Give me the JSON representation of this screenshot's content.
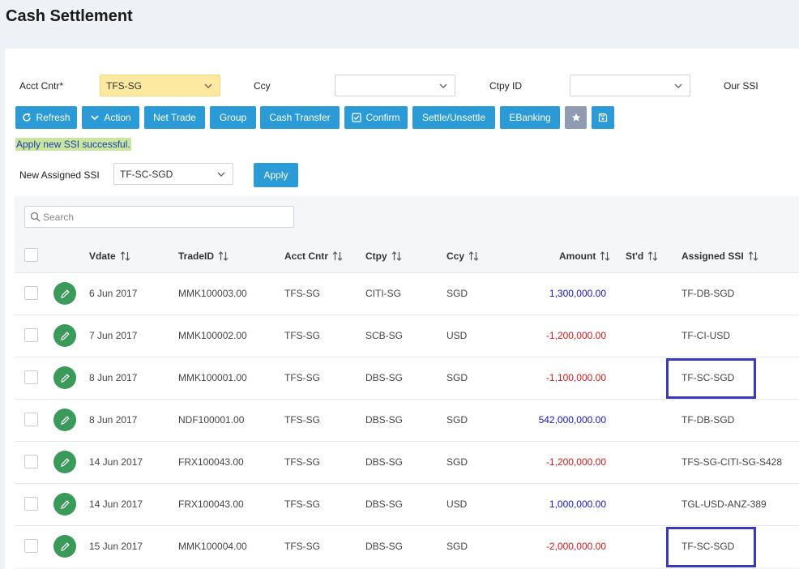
{
  "page": {
    "title": "Cash Settlement"
  },
  "filters": {
    "acct_cntr_label": "Acct Cntr*",
    "acct_cntr_value": "TFS-SG",
    "ccy_label": "Ccy",
    "ccy_value": "",
    "ctpy_label": "Ctpy ID",
    "ctpy_value": "",
    "our_ssi_label": "Our SSI"
  },
  "toolbar": {
    "refresh": "Refresh",
    "action": "Action",
    "net_trade": "Net Trade",
    "group": "Group",
    "cash_transfer": "Cash Transfer",
    "confirm": "Confirm",
    "settle": "Settle/Unsettle",
    "ebanking": "EBanking"
  },
  "message": "Apply new SSI successful.",
  "assign": {
    "label": "New Assigned SSI",
    "value": "TF-SC-SGD",
    "apply": "Apply"
  },
  "search": {
    "placeholder": "Search"
  },
  "columns": {
    "vdate": "Vdate",
    "tradeid": "TradeID",
    "acct": "Acct Cntr",
    "ctpy": "Ctpy",
    "ccy": "Ccy",
    "amount": "Amount",
    "std": "St'd",
    "ssi": "Assigned SSI"
  },
  "colors": {
    "accent": "#2a9bd6",
    "positive": "#1515c9",
    "negative": "#d01818",
    "highlight": "#3a3ab6"
  },
  "rows": [
    {
      "vdate": "6 Jun 2017",
      "tradeid": "MMK100003.00",
      "acct": "TFS-SG",
      "ctpy": "CITI-SG",
      "ccy": "SGD",
      "amount": "1,300,000.00",
      "sign": "pos",
      "std": "",
      "ssi": "TF-DB-SGD",
      "highlighted": false
    },
    {
      "vdate": "7 Jun 2017",
      "tradeid": "MMK100002.00",
      "acct": "TFS-SG",
      "ctpy": "SCB-SG",
      "ccy": "USD",
      "amount": "-1,200,000.00",
      "sign": "neg",
      "std": "",
      "ssi": "TF-CI-USD",
      "highlighted": false
    },
    {
      "vdate": "8 Jun 2017",
      "tradeid": "MMK100001.00",
      "acct": "TFS-SG",
      "ctpy": "DBS-SG",
      "ccy": "SGD",
      "amount": "-1,100,000.00",
      "sign": "neg",
      "std": "",
      "ssi": "TF-SC-SGD",
      "highlighted": true
    },
    {
      "vdate": "8 Jun 2017",
      "tradeid": "NDF100001.00",
      "acct": "TFS-SG",
      "ctpy": "DBS-SG",
      "ccy": "SGD",
      "amount": "542,000,000.00",
      "sign": "pos",
      "std": "",
      "ssi": "TF-DB-SGD",
      "highlighted": false
    },
    {
      "vdate": "14 Jun 2017",
      "tradeid": "FRX100043.00",
      "acct": "TFS-SG",
      "ctpy": "DBS-SG",
      "ccy": "SGD",
      "amount": "-1,200,000.00",
      "sign": "neg",
      "std": "",
      "ssi": "TFS-SG-CITI-SG-S428",
      "highlighted": false
    },
    {
      "vdate": "14 Jun 2017",
      "tradeid": "FRX100043.00",
      "acct": "TFS-SG",
      "ctpy": "DBS-SG",
      "ccy": "USD",
      "amount": "1,000,000.00",
      "sign": "pos",
      "std": "",
      "ssi": "TGL-USD-ANZ-389",
      "highlighted": false
    },
    {
      "vdate": "15 Jun 2017",
      "tradeid": "MMK100004.00",
      "acct": "TFS-SG",
      "ctpy": "DBS-SG",
      "ccy": "SGD",
      "amount": "-2,000,000.00",
      "sign": "neg",
      "std": "",
      "ssi": "TF-SC-SGD",
      "highlighted": true
    }
  ]
}
